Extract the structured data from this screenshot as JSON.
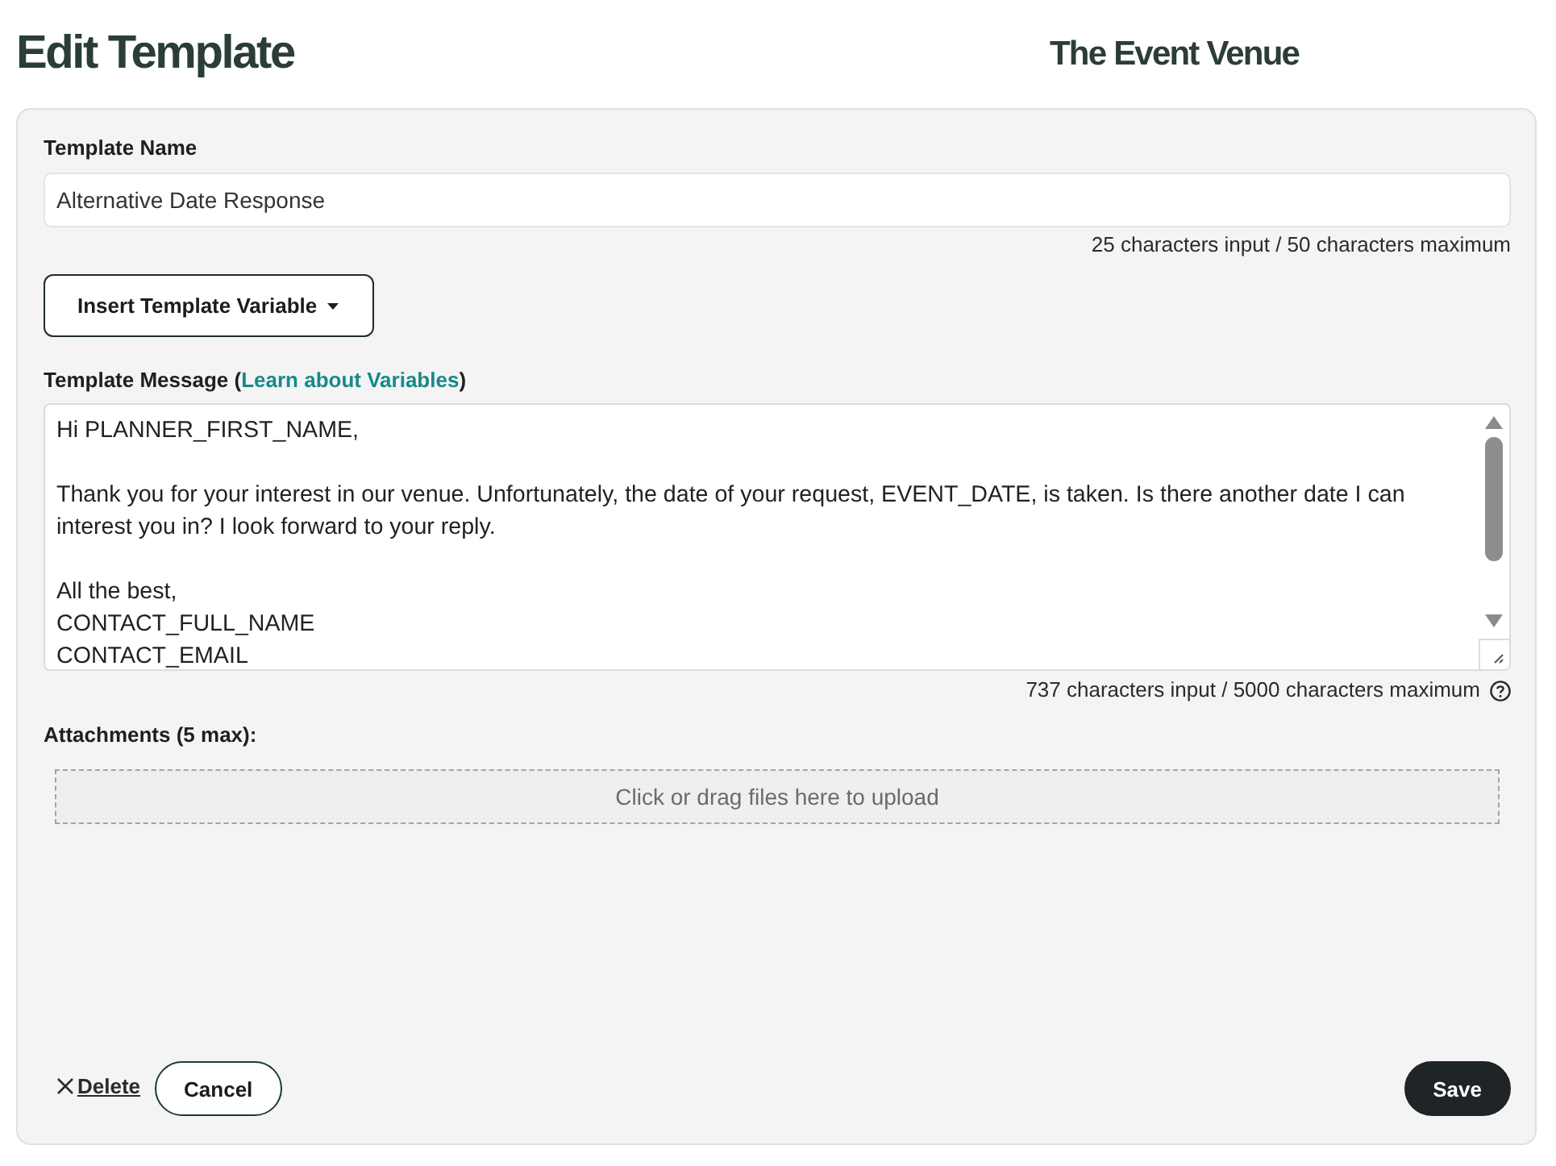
{
  "header": {
    "title": "Edit Template",
    "venue": "The Event Venue"
  },
  "template_name": {
    "label": "Template Name",
    "value": "Alternative Date Response",
    "counter": "25 characters input / 50 characters maximum"
  },
  "insert_variable_button": {
    "label": "Insert Template Variable"
  },
  "template_message": {
    "label_before": "Template Message (",
    "link": "Learn about Variables",
    "label_after": ")",
    "value": "Hi PLANNER_FIRST_NAME,\n\nThank you for your interest in our venue. Unfortunately, the date of your request, EVENT_DATE, is taken. Is there another date I can interest you in? I look forward to your reply.\n\nAll the best,\nCONTACT_FULL_NAME\nCONTACT_EMAIL",
    "counter": "737 characters input / 5000 characters maximum"
  },
  "attachments": {
    "label": "Attachments (5 max):",
    "dropzone": "Click or drag files here to upload"
  },
  "actions": {
    "delete": "Delete",
    "cancel": "Cancel",
    "save": "Save"
  }
}
